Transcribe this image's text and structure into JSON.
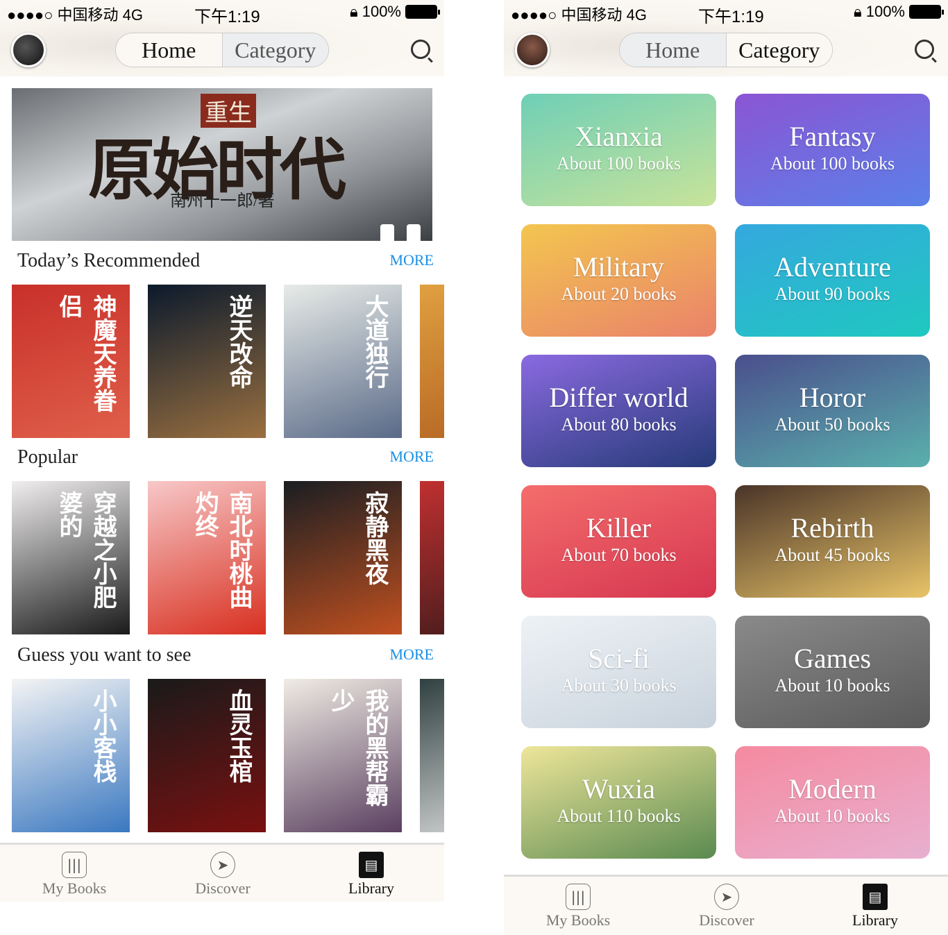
{
  "status": {
    "carrier": "●●●●○ 中国移动 4G",
    "time": "下午1:19",
    "battery": "100%"
  },
  "nav": {
    "home": "Home",
    "category": "Category"
  },
  "banner": {
    "tag": "重生",
    "title": "原始时代",
    "author": "南州十一郎/著"
  },
  "sections": [
    {
      "title": "Today’s Recommended",
      "more": "MORE",
      "covers": [
        {
          "title": "神魔天养眷侣",
          "colors": [
            "#c8302a",
            "#e0604a"
          ]
        },
        {
          "title": "逆天改命",
          "colors": [
            "#0b1a2c",
            "#9a7040"
          ]
        },
        {
          "title": "大道独行",
          "colors": [
            "#e8ece8",
            "#5a6a88"
          ]
        },
        {
          "title": "",
          "colors": [
            "#e0a040",
            "#b06020"
          ]
        }
      ]
    },
    {
      "title": "Popular",
      "more": "MORE",
      "covers": [
        {
          "title": "穿越之小肥婆的",
          "colors": [
            "#f0eeee",
            "#1a1a1a"
          ]
        },
        {
          "title": "南北时桃曲灼终",
          "colors": [
            "#f7c8c8",
            "#d83020"
          ]
        },
        {
          "title": "寂静黑夜",
          "colors": [
            "#1a1e22",
            "#c05020"
          ]
        },
        {
          "title": "",
          "colors": [
            "#c03030",
            "#3a1a1a"
          ]
        }
      ]
    },
    {
      "title": "Guess you want to see",
      "more": "MORE",
      "covers": [
        {
          "title": "小小客栈",
          "colors": [
            "#f4f4f4",
            "#3a78c0"
          ]
        },
        {
          "title": "血灵玉棺",
          "colors": [
            "#1a1a1a",
            "#7a1010"
          ]
        },
        {
          "title": "我的黑帮霸少",
          "colors": [
            "#f0ece4",
            "#5a4060"
          ]
        },
        {
          "title": "",
          "colors": [
            "#304040",
            "#e0e0e0"
          ]
        }
      ]
    }
  ],
  "tabbar": {
    "items": [
      {
        "label": "My Books",
        "icon": "bookshelf-icon"
      },
      {
        "label": "Discover",
        "icon": "compass-icon"
      },
      {
        "label": "Library",
        "icon": "store-icon"
      }
    ],
    "active": "Library"
  },
  "categories": [
    {
      "name": "Xianxia",
      "count": "About 100 books",
      "colors": [
        "#6fcfb6",
        "#c8e39a"
      ]
    },
    {
      "name": "Fantasy",
      "count": "About 100 books",
      "colors": [
        "#8b55d4",
        "#5b80e8"
      ]
    },
    {
      "name": "Military",
      "count": "About 20 books",
      "colors": [
        "#f3c64f",
        "#ea826a"
      ]
    },
    {
      "name": "Adventure",
      "count": "About 90 books",
      "colors": [
        "#35a8de",
        "#1fc8c0"
      ]
    },
    {
      "name": "Differ world",
      "count": "About 80 books",
      "colors": [
        "#8a6ae0",
        "#263a78"
      ]
    },
    {
      "name": "Horor",
      "count": "About 50 books",
      "colors": [
        "#4a4f8c",
        "#5ab0ac"
      ]
    },
    {
      "name": "Killer",
      "count": "About 70 books",
      "colors": [
        "#f46e6c",
        "#d63650"
      ]
    },
    {
      "name": "Rebirth",
      "count": "About 45 books",
      "colors": [
        "#4a3428",
        "#e8c468"
      ]
    },
    {
      "name": "Sci-fi",
      "count": "About 30 books",
      "colors": [
        "#eef2f6",
        "#c8d2dc"
      ]
    },
    {
      "name": "Games",
      "count": "About 10 books",
      "colors": [
        "#8a8a8a",
        "#5a5a5a"
      ]
    },
    {
      "name": "Wuxia",
      "count": "About 110 books",
      "colors": [
        "#eee69a",
        "#5a8a50"
      ]
    },
    {
      "name": "Modern",
      "count": "About 10 books",
      "colors": [
        "#f58aa0",
        "#e8b0d0"
      ]
    }
  ]
}
